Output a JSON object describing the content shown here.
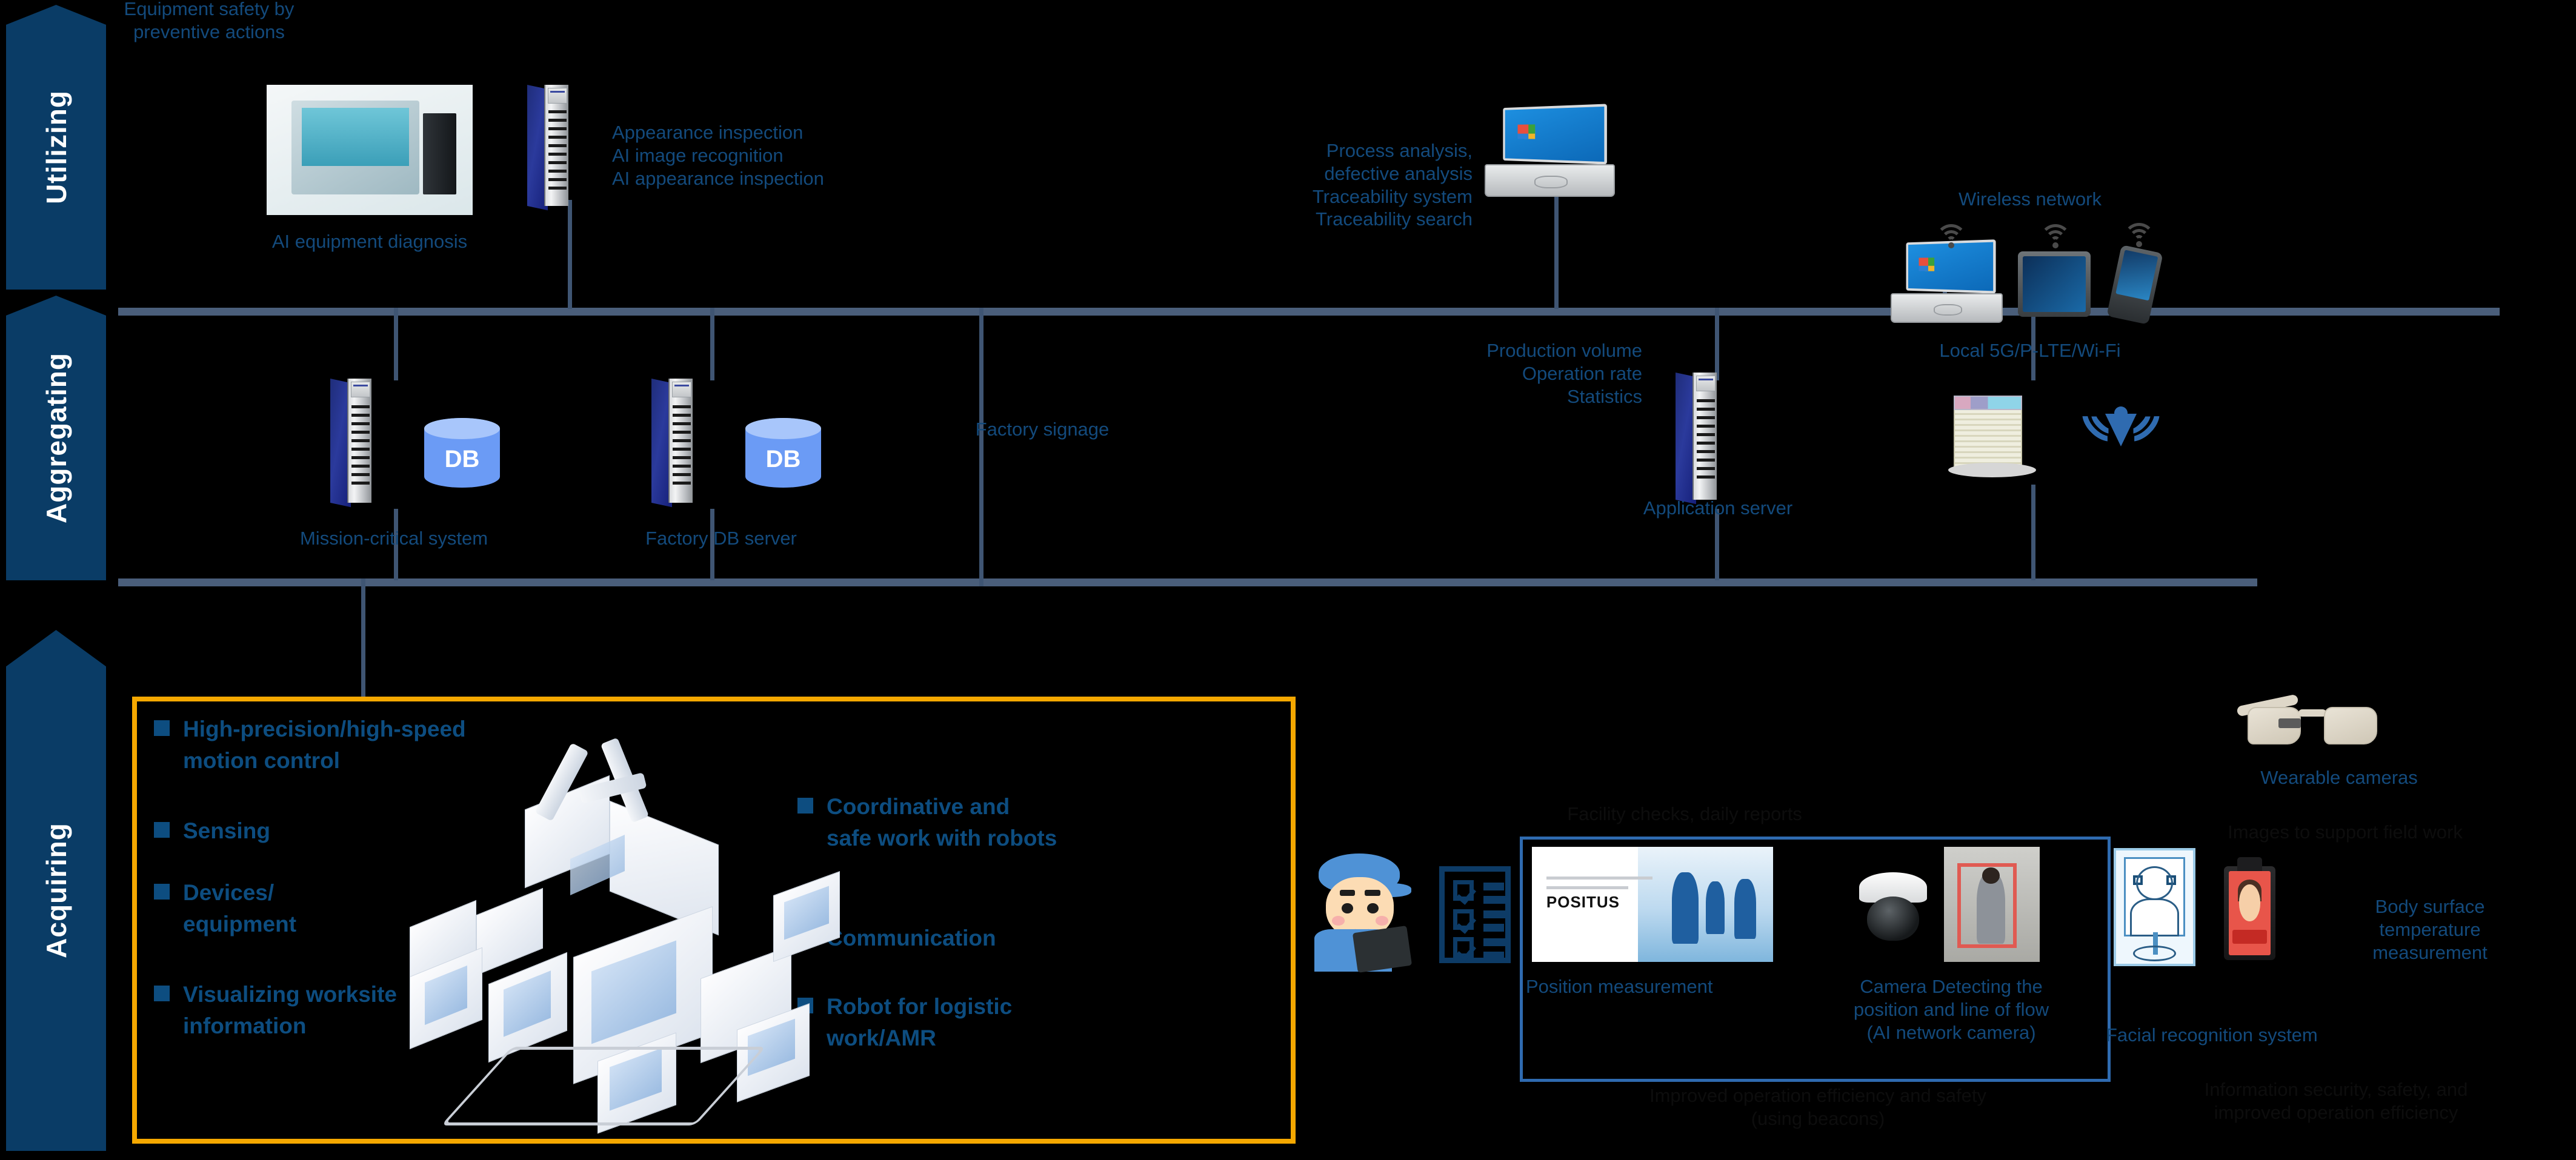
{
  "stages": [
    {
      "key": "utilizing",
      "label": "Utilizing"
    },
    {
      "key": "aggregating",
      "label": "Aggregating"
    },
    {
      "key": "acquiring",
      "label": "Acquiring"
    }
  ],
  "utilizing": {
    "equipment_safety": "Equipment safety by\npreventive actions",
    "ai_equipment_diagnosis": "AI equipment diagnosis",
    "appearance_inspection": "Appearance inspection\nAI image recognition\nAI appearance inspection",
    "process_analysis": "Process analysis,\ndefective analysis\nTraceability system\nTraceability search",
    "wireless_network": "Wireless network",
    "local_5g": "Local 5G/P-LTE/Wi-Fi"
  },
  "aggregating": {
    "mission_critical_system": "Mission-critical system",
    "factory_db_server": "Factory DB server",
    "db_badge": "DB",
    "factory_signage": "Factory signage",
    "production_stats": "Production volume\nOperation rate\nStatistics",
    "application_server": "Application server"
  },
  "acquiring": {
    "bullets_left": [
      "High-precision/high-speed\nmotion control",
      "Sensing",
      "Devices/\nequipment",
      "Visualizing worksite\ninformation"
    ],
    "bullets_right": [
      "Coordinative and\nsafe work with robots",
      "Communication",
      "Robot for logistic\nwork/AMR"
    ],
    "facility_checks": "Facility checks, daily reports",
    "position_measurement": "Position measurement",
    "camera_detecting": "Camera Detecting the\nposition and line of flow\n(AI network camera)",
    "improved_operation": "Improved operation efficiency and safety\n(using beacons)",
    "wearable_cameras": "Wearable cameras",
    "images_support": "Images to support field work",
    "facial_recognition": "Facial recognition system",
    "body_temperature": "Body surface\ntemperature\nmeasurement",
    "information_security": "Information security, safety, and\nimproved operation efficiency",
    "positus_brand": "POSITUS"
  },
  "colors": {
    "stage_arrow": "#0a3c66",
    "label_blue": "#134a7c",
    "bullet_blue": "#0d4d80",
    "accent_yellow": "#f5a800",
    "bus_line": "#4a5e7a",
    "group_box_blue": "#2f6bb0",
    "dark_text": "#0d0d0d",
    "background": "#000000"
  }
}
